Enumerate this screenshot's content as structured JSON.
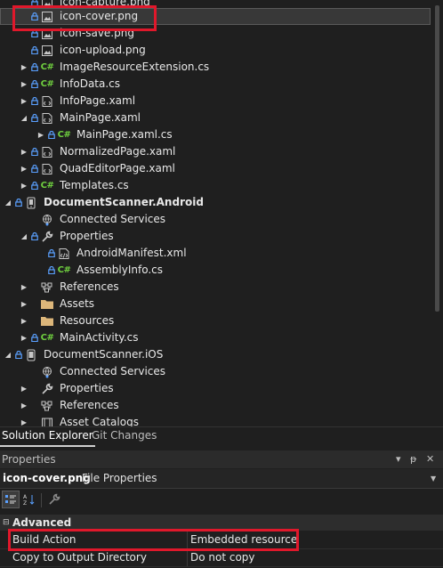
{
  "solution_explorer": {
    "items": [
      {
        "label": "icon-capture.png",
        "icon": "image-file-icon",
        "lock": true
      },
      {
        "label": "icon-cover.png",
        "icon": "image-file-icon",
        "lock": true,
        "selected": true
      },
      {
        "label": "icon-save.png",
        "icon": "image-file-icon",
        "lock": true
      },
      {
        "label": "icon-upload.png",
        "icon": "image-file-icon",
        "lock": true
      },
      {
        "label": "ImageResourceExtension.cs",
        "icon": "csharp-icon",
        "lock": true,
        "expander": "collapsed"
      },
      {
        "label": "InfoData.cs",
        "icon": "csharp-icon",
        "lock": true,
        "expander": "collapsed"
      },
      {
        "label": "InfoPage.xaml",
        "icon": "xaml-icon",
        "lock": true,
        "expander": "collapsed"
      },
      {
        "label": "MainPage.xaml",
        "icon": "xaml-icon",
        "lock": true,
        "expander": "expanded"
      },
      {
        "label": "MainPage.xaml.cs",
        "icon": "csharp-icon",
        "lock": true,
        "expander": "collapsed"
      },
      {
        "label": "NormalizedPage.xaml",
        "icon": "xaml-icon",
        "lock": true,
        "expander": "collapsed"
      },
      {
        "label": "QuadEditorPage.xaml",
        "icon": "xaml-icon",
        "lock": true,
        "expander": "collapsed"
      },
      {
        "label": "Templates.cs",
        "icon": "csharp-icon",
        "lock": true,
        "expander": "collapsed"
      },
      {
        "label": "DocumentScanner.Android",
        "icon": "android-project-icon",
        "lock": true,
        "expander": "expanded",
        "bold": true
      },
      {
        "label": "Connected Services",
        "icon": "connected-services-icon",
        "lock": false
      },
      {
        "label": "Properties",
        "icon": "wrench-icon",
        "lock": true,
        "expander": "expanded"
      },
      {
        "label": "AndroidManifest.xml",
        "icon": "xml-file-icon",
        "lock": true
      },
      {
        "label": "AssemblyInfo.cs",
        "icon": "csharp-icon",
        "lock": true
      },
      {
        "label": "References",
        "icon": "references-icon",
        "lock": false,
        "expander": "collapsed"
      },
      {
        "label": "Assets",
        "icon": "folder-icon",
        "lock": false,
        "expander": "collapsed"
      },
      {
        "label": "Resources",
        "icon": "folder-icon",
        "lock": false,
        "expander": "collapsed"
      },
      {
        "label": "MainActivity.cs",
        "icon": "csharp-icon",
        "lock": true,
        "expander": "collapsed"
      },
      {
        "label": "DocumentScanner.iOS",
        "icon": "ios-project-icon",
        "lock": true,
        "expander": "expanded"
      },
      {
        "label": "Connected Services",
        "icon": "connected-services-icon",
        "lock": false
      },
      {
        "label": "Properties",
        "icon": "wrench-icon",
        "lock": false,
        "expander": "collapsed"
      },
      {
        "label": "References",
        "icon": "references-icon",
        "lock": false,
        "expander": "collapsed"
      },
      {
        "label": "Asset Catalogs",
        "icon": "asset-catalog-icon",
        "lock": false,
        "expander": "collapsed"
      }
    ],
    "csharp_glyph": "C#"
  },
  "tabs": {
    "solution_explorer": "Solution Explorer",
    "git_changes": "Git Changes"
  },
  "properties": {
    "title": "Properties",
    "title_buttons": {
      "dropdown": "▾",
      "pin": "ᵽ",
      "close": "✕"
    },
    "object_name": "icon-cover.png",
    "object_kind": "File Properties",
    "category": "Advanced",
    "rows": [
      {
        "name": "Build Action",
        "value": "Embedded resource"
      },
      {
        "name": "Copy to Output Directory",
        "value": "Do not copy"
      }
    ]
  },
  "colors": {
    "highlight": "#e0182b",
    "csharp": "#6fcf3f",
    "lock": "#5aa0ff",
    "folder": "#dcb67a"
  }
}
